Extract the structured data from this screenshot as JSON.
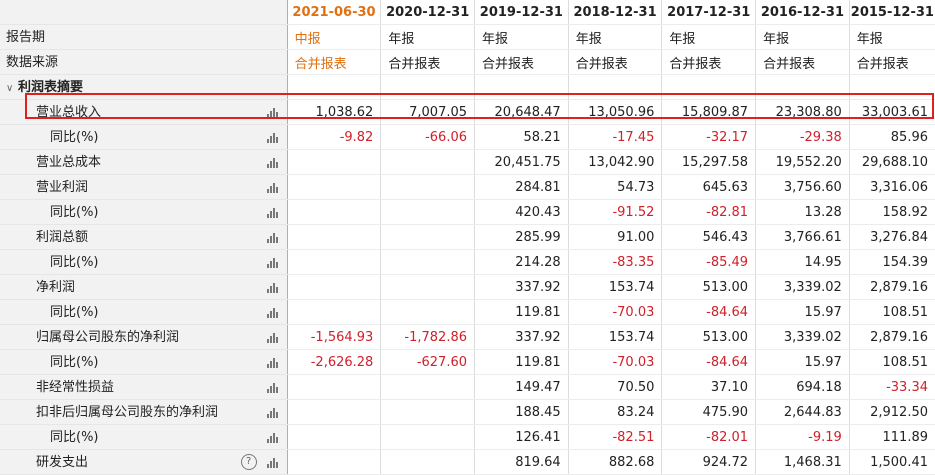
{
  "headers": {
    "dates": [
      "2021-06-30",
      "2020-12-31",
      "2019-12-31",
      "2018-12-31",
      "2017-12-31",
      "2016-12-31",
      "2015-12-31"
    ]
  },
  "meta_rows": [
    {
      "label": "报告期",
      "values": [
        "中报",
        "年报",
        "年报",
        "年报",
        "年报",
        "年报",
        "年报"
      ]
    },
    {
      "label": "数据来源",
      "values": [
        "合并报表",
        "合并报表",
        "合并报表",
        "合并报表",
        "合并报表",
        "合并报表",
        "合并报表"
      ]
    }
  ],
  "section": {
    "label": "利润表摘要"
  },
  "rows": [
    {
      "label": "营业总收入",
      "indent": 1,
      "values": [
        "1,038.62",
        "7,007.05",
        "20,648.47",
        "13,050.96",
        "15,809.87",
        "23,308.80",
        "33,003.61"
      ]
    },
    {
      "label": "同比(%)",
      "indent": 2,
      "values": [
        "-9.82",
        "-66.06",
        "58.21",
        "-17.45",
        "-32.17",
        "-29.38",
        "85.96"
      ]
    },
    {
      "label": "营业总成本",
      "indent": 1,
      "values": [
        "",
        "",
        "20,451.75",
        "13,042.90",
        "15,297.58",
        "19,552.20",
        "29,688.10"
      ]
    },
    {
      "label": "营业利润",
      "indent": 1,
      "values": [
        "",
        "",
        "284.81",
        "54.73",
        "645.63",
        "3,756.60",
        "3,316.06"
      ]
    },
    {
      "label": "同比(%)",
      "indent": 2,
      "values": [
        "",
        "",
        "420.43",
        "-91.52",
        "-82.81",
        "13.28",
        "158.92"
      ]
    },
    {
      "label": "利润总额",
      "indent": 1,
      "values": [
        "",
        "",
        "285.99",
        "91.00",
        "546.43",
        "3,766.61",
        "3,276.84"
      ]
    },
    {
      "label": "同比(%)",
      "indent": 2,
      "values": [
        "",
        "",
        "214.28",
        "-83.35",
        "-85.49",
        "14.95",
        "154.39"
      ]
    },
    {
      "label": "净利润",
      "indent": 1,
      "values": [
        "",
        "",
        "337.92",
        "153.74",
        "513.00",
        "3,339.02",
        "2,879.16"
      ]
    },
    {
      "label": "同比(%)",
      "indent": 2,
      "values": [
        "",
        "",
        "119.81",
        "-70.03",
        "-84.64",
        "15.97",
        "108.51"
      ]
    },
    {
      "label": "归属母公司股东的净利润",
      "indent": 1,
      "values": [
        "-1,564.93",
        "-1,782.86",
        "337.92",
        "153.74",
        "513.00",
        "3,339.02",
        "2,879.16"
      ]
    },
    {
      "label": "同比(%)",
      "indent": 2,
      "values": [
        "-2,626.28",
        "-627.60",
        "119.81",
        "-70.03",
        "-84.64",
        "15.97",
        "108.51"
      ]
    },
    {
      "label": "非经常性损益",
      "indent": 1,
      "values": [
        "",
        "",
        "149.47",
        "70.50",
        "37.10",
        "694.18",
        "-33.34"
      ]
    },
    {
      "label": "扣非后归属母公司股东的净利润",
      "indent": 1,
      "values": [
        "",
        "",
        "188.45",
        "83.24",
        "475.90",
        "2,644.83",
        "2,912.50"
      ]
    },
    {
      "label": "同比(%)",
      "indent": 2,
      "values": [
        "",
        "",
        "126.41",
        "-82.51",
        "-82.01",
        "-9.19",
        "111.89"
      ]
    },
    {
      "label": "研发支出",
      "indent": 1,
      "help": true,
      "values": [
        "",
        "",
        "819.64",
        "882.68",
        "924.72",
        "1,468.31",
        "1,500.41"
      ]
    }
  ],
  "icons": {
    "chart": "bar-chart-icon",
    "help": "help-icon",
    "collapse": "collapse-arrow-icon"
  },
  "help_glyph": "?",
  "colors": {
    "accent": "#e07010",
    "negative": "#d0202a",
    "highlight": "#e02020",
    "label_bg": "#f2f2f2"
  }
}
